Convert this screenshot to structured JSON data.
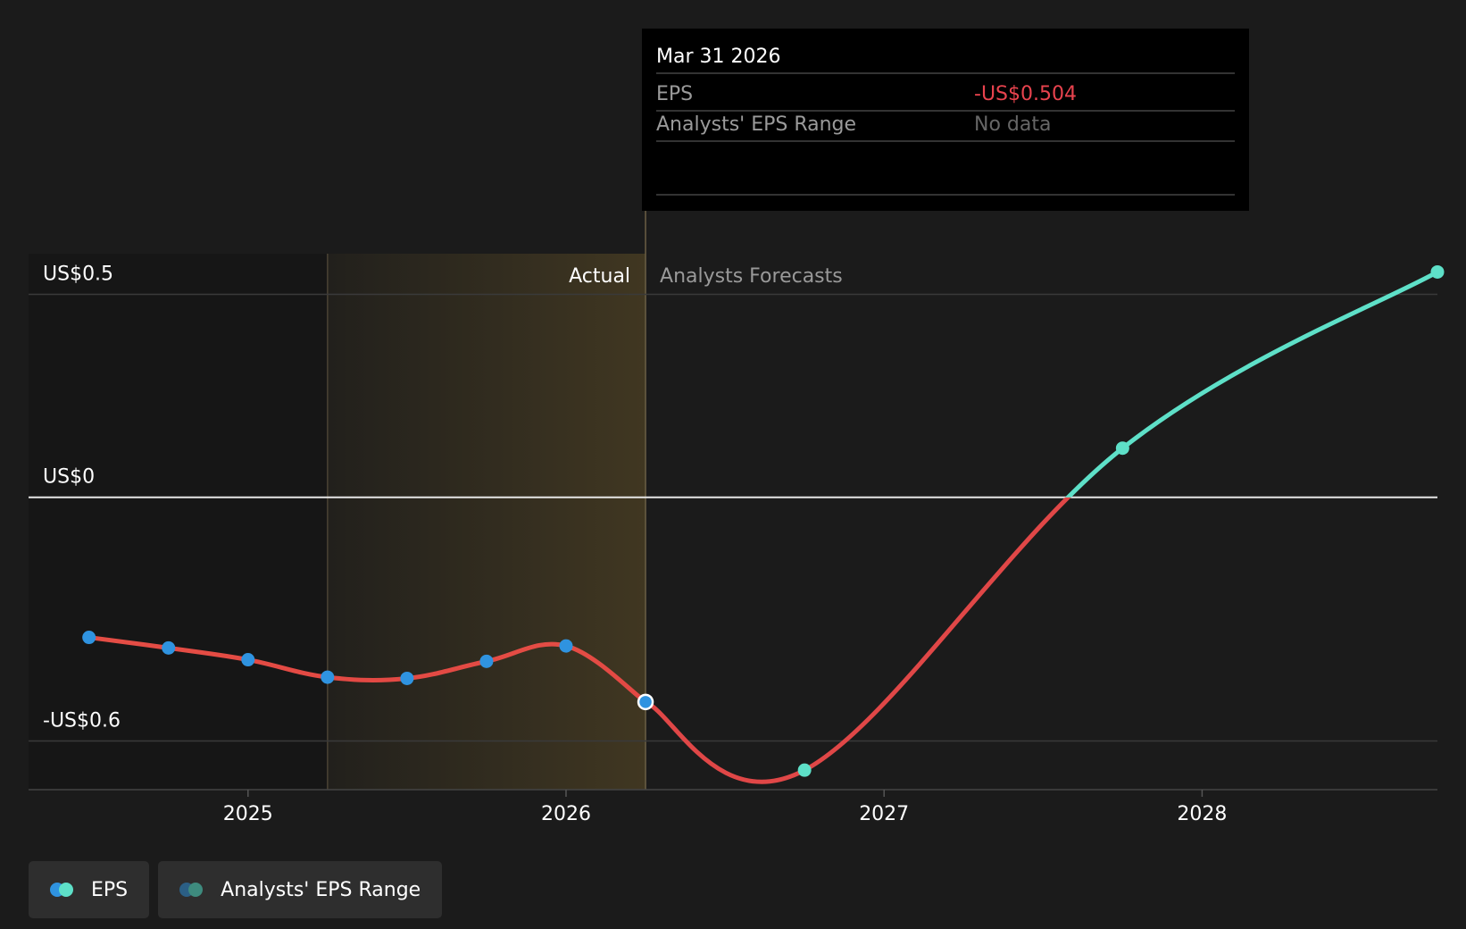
{
  "colors": {
    "background": "#1b1b1b",
    "eps_actual_line": "#e04747",
    "eps_forecast_line": "#5ee0c8",
    "actual_point": "#2f93e0",
    "forecast_point": "#5ee0c8",
    "negative_text": "#e8434e",
    "shade": "#c49a38"
  },
  "tooltip": {
    "date": "Mar 31 2026",
    "rows": [
      {
        "label": "EPS",
        "value": "-US$0.504"
      },
      {
        "label": "Analysts' EPS Range",
        "value": "No data"
      }
    ]
  },
  "divider_labels": {
    "actual": "Actual",
    "forecast": "Analysts Forecasts"
  },
  "legend": [
    {
      "label": "EPS",
      "icon": "eps-legend-icon",
      "colors": [
        "#2f93e0",
        "#5ee0c8"
      ]
    },
    {
      "label": "Analysts' EPS Range",
      "icon": "eps-range-legend-icon",
      "colors": [
        "#2b5f85",
        "#3e8b7e"
      ]
    }
  ],
  "chart_data": {
    "type": "line",
    "title": "",
    "xlabel": "",
    "ylabel": "",
    "x_ticks": [
      {
        "label": "2025",
        "x": 2025.0
      },
      {
        "label": "2026",
        "x": 2026.0
      },
      {
        "label": "2027",
        "x": 2027.0
      },
      {
        "label": "2028",
        "x": 2028.0
      }
    ],
    "y_ticks": [
      {
        "label": "US$0.5",
        "y": 0.5
      },
      {
        "label": "US$0",
        "y": 0
      },
      {
        "label": "-US$0.6",
        "y": -0.6
      }
    ],
    "xlim": [
      2024.31,
      2028.74
    ],
    "ylim": [
      -0.72,
      0.6
    ],
    "actual_region": {
      "start": 2025.25,
      "end": 2026.25
    },
    "series": [
      {
        "name": "EPS",
        "segment": "actual",
        "points": [
          {
            "date": "2024-06-30",
            "x": 2024.5,
            "y": -0.345
          },
          {
            "date": "2024-09-30",
            "x": 2024.75,
            "y": -0.371
          },
          {
            "date": "2024-12-31",
            "x": 2025.0,
            "y": -0.4
          },
          {
            "date": "2025-03-31",
            "x": 2025.25,
            "y": -0.443
          },
          {
            "date": "2025-06-30",
            "x": 2025.5,
            "y": -0.446
          },
          {
            "date": "2025-09-30",
            "x": 2025.75,
            "y": -0.404
          },
          {
            "date": "2025-12-31",
            "x": 2026.0,
            "y": -0.366
          },
          {
            "date": "2026-03-31",
            "x": 2026.25,
            "y": -0.504
          }
        ]
      },
      {
        "name": "EPS",
        "segment": "forecast",
        "points": [
          {
            "date": "2026-03-31",
            "x": 2026.25,
            "y": -0.504
          },
          {
            "date": "2026-09-30",
            "x": 2026.75,
            "y": -0.672
          },
          {
            "date": "2027-09-30",
            "x": 2027.75,
            "y": 0.121
          },
          {
            "date": "2028-09-30",
            "x": 2028.74,
            "y": 0.555
          }
        ]
      }
    ]
  }
}
